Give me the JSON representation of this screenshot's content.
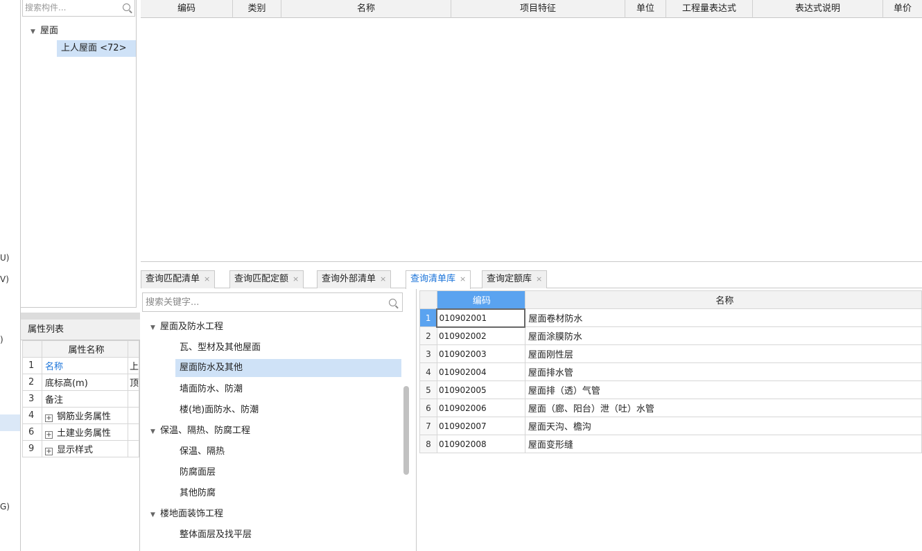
{
  "left_strip": {
    "fragments": [
      "U)",
      "V)",
      ")",
      "G)"
    ]
  },
  "component_panel": {
    "search_placeholder": "搜索构件...",
    "tree": {
      "root_label": "屋面",
      "child_label": "上人屋面 <72>"
    }
  },
  "property_panel": {
    "title": "属性列表",
    "header": {
      "name_col": "属性名称"
    },
    "rows": [
      {
        "idx": "1",
        "name": "名称",
        "value": "上",
        "expandable": false,
        "highlight": true
      },
      {
        "idx": "2",
        "name": "底标高(m)",
        "value": "顶",
        "expandable": false,
        "highlight": false
      },
      {
        "idx": "3",
        "name": "备注",
        "value": "",
        "expandable": false,
        "highlight": false
      },
      {
        "idx": "4",
        "name": "钢筋业务属性",
        "value": "",
        "expandable": true,
        "highlight": false
      },
      {
        "idx": "6",
        "name": "土建业务属性",
        "value": "",
        "expandable": true,
        "highlight": false
      },
      {
        "idx": "9",
        "name": "显示样式",
        "value": "",
        "expandable": true,
        "highlight": false
      }
    ]
  },
  "top_grid": {
    "columns": [
      "编码",
      "类别",
      "名称",
      "项目特征",
      "单位",
      "工程量表达式",
      "表达式说明",
      "单价"
    ]
  },
  "tabs": [
    {
      "label": "查询匹配清单",
      "active": false
    },
    {
      "label": "查询匹配定额",
      "active": false
    },
    {
      "label": "查询外部清单",
      "active": false
    },
    {
      "label": "查询清单库",
      "active": true
    },
    {
      "label": "查询定额库",
      "active": false
    }
  ],
  "tab_close_glyph": "×",
  "category_panel": {
    "search_placeholder": "搜索关键字...",
    "items": [
      {
        "label": "屋面及防水工程",
        "level": 1,
        "expanded": true
      },
      {
        "label": "瓦、型材及其他屋面",
        "level": 2
      },
      {
        "label": "屋面防水及其他",
        "level": 2,
        "selected": true
      },
      {
        "label": "墙面防水、防潮",
        "level": 2
      },
      {
        "label": "楼(地)面防水、防潮",
        "level": 2
      },
      {
        "label": "保温、隔热、防腐工程",
        "level": 1,
        "expanded": true
      },
      {
        "label": "保温、隔热",
        "level": 2
      },
      {
        "label": "防腐面层",
        "level": 2
      },
      {
        "label": "其他防腐",
        "level": 2
      },
      {
        "label": "楼地面装饰工程",
        "level": 1,
        "expanded": true
      },
      {
        "label": "整体面层及找平层",
        "level": 2
      }
    ]
  },
  "result_table": {
    "headers": {
      "code": "编码",
      "name": "名称"
    },
    "rows": [
      {
        "idx": "1",
        "code": "010902001",
        "name": "屋面卷材防水",
        "selected": true
      },
      {
        "idx": "2",
        "code": "010902002",
        "name": "屋面涂膜防水"
      },
      {
        "idx": "3",
        "code": "010902003",
        "name": "屋面刚性层"
      },
      {
        "idx": "4",
        "code": "010902004",
        "name": "屋面排水管"
      },
      {
        "idx": "5",
        "code": "010902005",
        "name": "屋面排（透）气管"
      },
      {
        "idx": "6",
        "code": "010902006",
        "name": "屋面（廊、阳台）泄（吐）水管"
      },
      {
        "idx": "7",
        "code": "010902007",
        "name": "屋面天沟、檐沟"
      },
      {
        "idx": "8",
        "code": "010902008",
        "name": "屋面变形缝"
      }
    ]
  },
  "colors": {
    "accent_blue": "#1a73d9",
    "selection_bg": "#cfe2f7",
    "header_blue": "#5aa3f0",
    "highlight_text": "#1a73d9"
  }
}
